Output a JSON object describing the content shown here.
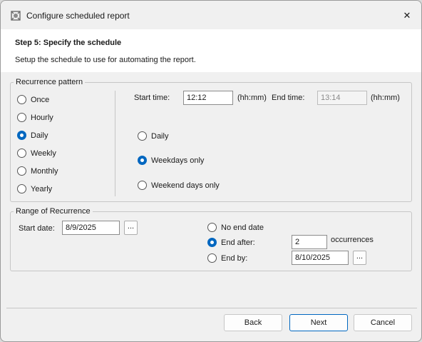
{
  "window": {
    "title": "Configure scheduled report",
    "close_glyph": "✕"
  },
  "header": {
    "step_title": "Step 5: Specify the schedule",
    "description": "Setup the schedule to use for automating the report."
  },
  "recurrence": {
    "group_label": "Recurrence pattern",
    "patterns": [
      {
        "label": "Once",
        "checked": false
      },
      {
        "label": "Hourly",
        "checked": false
      },
      {
        "label": "Daily",
        "checked": true
      },
      {
        "label": "Weekly",
        "checked": false
      },
      {
        "label": "Monthly",
        "checked": false
      },
      {
        "label": "Yearly",
        "checked": false
      }
    ],
    "start_time_label": "Start time:",
    "start_time": "12:12",
    "start_time_unit": "(hh:mm)",
    "end_time_label": "End time:",
    "end_time": "13:14",
    "end_time_unit": "(hh:mm)",
    "daily_options": [
      {
        "label": "Daily",
        "checked": false
      },
      {
        "label": "Weekdays only",
        "checked": true
      },
      {
        "label": "Weekend days only",
        "checked": false
      }
    ]
  },
  "range": {
    "group_label": "Range of Recurrence",
    "start_date_label": "Start date:",
    "start_date": "8/9/2025",
    "browse_label": "...",
    "no_end_label": "No end date",
    "end_after_label": "End after:",
    "occurrences_value": "2",
    "occurrences_label": "occurrences",
    "end_by_label": "End by:",
    "end_by_date": "8/10/2025",
    "end_selection": "end_after"
  },
  "buttons": {
    "back": "Back",
    "next": "Next",
    "cancel": "Cancel"
  },
  "colors": {
    "accent": "#0067c0",
    "window_bg": "#f0f0f0",
    "header_bg": "#ffffff"
  }
}
